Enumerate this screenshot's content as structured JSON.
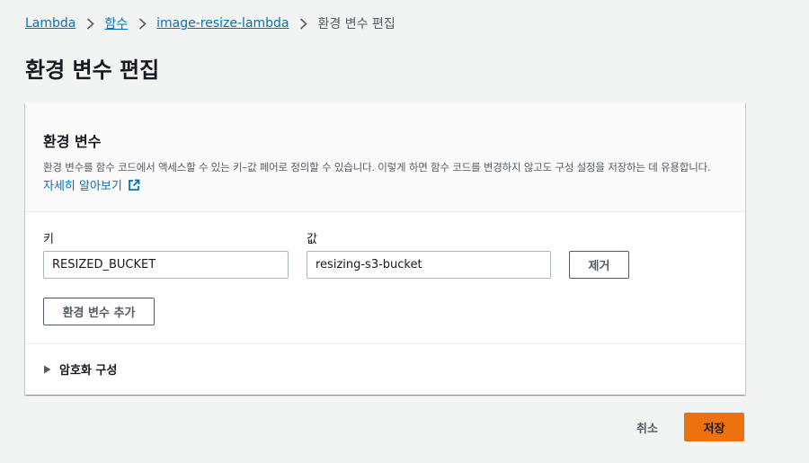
{
  "breadcrumb": {
    "items": [
      "Lambda",
      "함수",
      "image-resize-lambda"
    ],
    "current": "환경 변수 편집"
  },
  "page": {
    "title": "환경 변수 편집"
  },
  "panel": {
    "title": "환경 변수",
    "description": "환경 변수를 함수 코드에서 액세스할 수 있는 키–값 페어로 정의할 수 있습니다. 이렇게 하면 함수 코드를 변경하지 않고도 구성 설정을 저장하는 데 유용합니다.",
    "learn_more": "자세히 알아보기",
    "key_label": "키",
    "value_label": "값",
    "variables": [
      {
        "key": "RESIZED_BUCKET",
        "value": "resizing-s3-bucket"
      }
    ],
    "remove_label": "제거",
    "add_label": "환경 변수 추가",
    "encryption_label": "암호화 구성"
  },
  "footer": {
    "cancel_label": "취소",
    "save_label": "저장"
  },
  "colors": {
    "accent": "#ec7211",
    "link": "#0073bb",
    "background": "#f2f3f3"
  },
  "icons": {
    "breadcrumb_separator": "chevron-right-icon",
    "external_link": "external-link-icon",
    "expander": "caret-right-icon"
  }
}
